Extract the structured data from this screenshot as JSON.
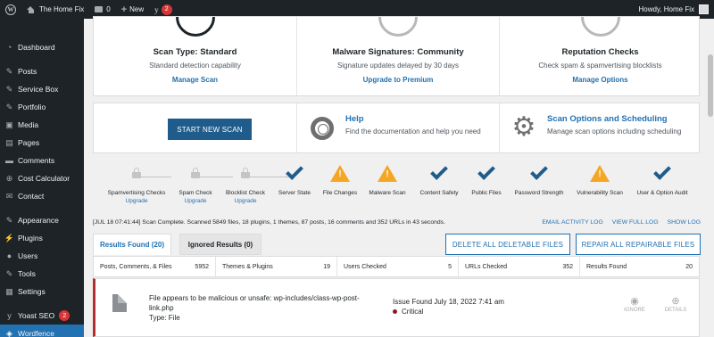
{
  "adminbar": {
    "site_name": "The Home Fix",
    "comments_count": "0",
    "new_label": "New",
    "yoast_badge": "2",
    "greeting": "Howdy, Home Fix"
  },
  "sidebar": {
    "items": [
      {
        "label": "Dashboard",
        "icon": "dashboard-icon"
      },
      {
        "label": "Posts",
        "icon": "pin-icon"
      },
      {
        "label": "Service Box",
        "icon": "wrench-icon"
      },
      {
        "label": "Portfolio",
        "icon": "wrench-icon"
      },
      {
        "label": "Media",
        "icon": "media-icon"
      },
      {
        "label": "Pages",
        "icon": "pages-icon"
      },
      {
        "label": "Comments",
        "icon": "comment-icon"
      },
      {
        "label": "Cost Calculator",
        "icon": "plus-circle-icon"
      },
      {
        "label": "Contact",
        "icon": "mail-icon"
      },
      {
        "label": "Appearance",
        "icon": "brush-icon"
      },
      {
        "label": "Plugins",
        "icon": "plug-icon"
      },
      {
        "label": "Users",
        "icon": "user-icon"
      },
      {
        "label": "Tools",
        "icon": "wrench-icon"
      },
      {
        "label": "Settings",
        "icon": "settings-icon"
      },
      {
        "label": "Yoast SEO",
        "icon": "yoast-icon",
        "badge": "2"
      },
      {
        "label": "Wordfence",
        "icon": "wordfence-icon"
      }
    ]
  },
  "summary": [
    {
      "title": "Scan Type: Standard",
      "desc": "Standard detection capability",
      "link": "Manage Scan"
    },
    {
      "title": "Malware Signatures: Community",
      "desc": "Signature updates delayed by 30 days",
      "link": "Upgrade to Premium"
    },
    {
      "title": "Reputation Checks",
      "desc": "Check spam & spamvertising blocklists",
      "link": "Manage Options"
    }
  ],
  "actions": {
    "start_scan": "START NEW SCAN",
    "help_title": "Help",
    "help_desc": "Find the documentation and help you need",
    "options_title": "Scan Options and Scheduling",
    "options_desc": "Manage scan options including scheduling"
  },
  "steps": [
    {
      "label": "Spamvertising Checks",
      "sub": "Upgrade",
      "status": "locked"
    },
    {
      "label": "Spam Check",
      "sub": "Upgrade",
      "status": "locked"
    },
    {
      "label": "Blocklist Check",
      "sub": "Upgrade",
      "status": "locked"
    },
    {
      "label": "Server State",
      "sub": "",
      "status": "ok"
    },
    {
      "label": "File Changes",
      "sub": "",
      "status": "warning"
    },
    {
      "label": "Malware Scan",
      "sub": "",
      "status": "warning"
    },
    {
      "label": "Content Safety",
      "sub": "",
      "status": "ok"
    },
    {
      "label": "Public Files",
      "sub": "",
      "status": "ok"
    },
    {
      "label": "Password Strength",
      "sub": "",
      "status": "ok"
    },
    {
      "label": "Vulnerability Scan",
      "sub": "",
      "status": "warning"
    },
    {
      "label": "User & Option Audit",
      "sub": "",
      "status": "ok"
    }
  ],
  "status": {
    "text": "[JUL 18 07:41:44] Scan Complete. Scanned 5849 files, 18 plugins, 1 themes, 87 posts, 16 comments and 352 URLs in 43 seconds.",
    "links": [
      "EMAIL ACTIVITY LOG",
      "VIEW FULL LOG",
      "SHOW LOG"
    ]
  },
  "tabs": {
    "found": "Results Found (20)",
    "ignored": "Ignored Results (0)",
    "delete_all": "DELETE ALL DELETABLE FILES",
    "repair_all": "REPAIR ALL REPAIRABLE FILES"
  },
  "counts": [
    {
      "label": "Posts, Comments, & Files",
      "value": "5952"
    },
    {
      "label": "Themes & Plugins",
      "value": "19"
    },
    {
      "label": "Users Checked",
      "value": "5"
    },
    {
      "label": "URLs Checked",
      "value": "352"
    },
    {
      "label": "Results Found",
      "value": "20"
    }
  ],
  "issue": {
    "title": "File appears to be malicious or unsafe: wp-includes/class-wp-post-link.php",
    "type": "Type: File",
    "found": "Issue Found July 18, 2022 7:41 am",
    "severity": "Critical",
    "ignore": "IGNORE",
    "details": "DETAILS"
  },
  "colors": {
    "accent": "#2271b1",
    "button": "#1f5c8b",
    "warning": "#f5a623",
    "critical": "#b32d2e",
    "admin_dark": "#1d2327"
  }
}
